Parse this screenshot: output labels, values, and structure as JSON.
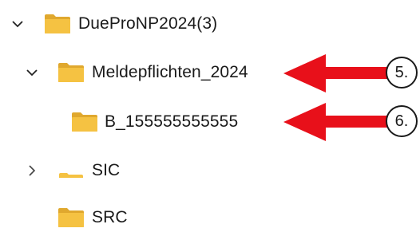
{
  "tree": {
    "items": [
      {
        "label": "DueProNP2024(3)",
        "expanded": true,
        "icon": "folder-icon"
      },
      {
        "label": "Meldepflichten_2024",
        "expanded": true,
        "icon": "folder-icon"
      },
      {
        "label": "B_155555555555",
        "icon": "folder-icon"
      },
      {
        "label": "SIC",
        "expanded": false,
        "icon": "folder-empty-icon"
      },
      {
        "label": "SRC",
        "icon": "folder-icon"
      }
    ]
  },
  "callouts": [
    {
      "number": "5."
    },
    {
      "number": "6."
    }
  ],
  "colors": {
    "folder": "#f5c242",
    "folder_dark": "#e0a82e",
    "arrow": "#e8101a"
  }
}
